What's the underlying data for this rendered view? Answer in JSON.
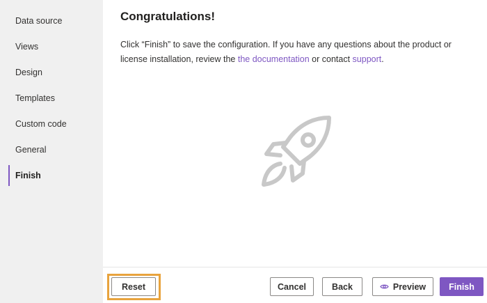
{
  "sidebar": {
    "items": [
      {
        "label": "Data source",
        "active": false
      },
      {
        "label": "Views",
        "active": false
      },
      {
        "label": "Design",
        "active": false
      },
      {
        "label": "Templates",
        "active": false
      },
      {
        "label": "Custom code",
        "active": false
      },
      {
        "label": "General",
        "active": false
      },
      {
        "label": "Finish",
        "active": true
      }
    ]
  },
  "main": {
    "title": "Congratulations!",
    "desc_before": "Click “Finish” to save the configuration. If you have any questions about the product or license installation, review the ",
    "doc_link": "the documentation",
    "desc_middle": " or contact ",
    "support_link": "support",
    "desc_end": ".",
    "illustration_icon": "rocket-icon"
  },
  "footer": {
    "reset_label": "Reset",
    "cancel_label": "Cancel",
    "back_label": "Back",
    "preview_label": "Preview",
    "preview_icon": "eye-icon",
    "finish_label": "Finish"
  },
  "colors": {
    "accent": "#7e57c2",
    "highlight": "#e8a33d",
    "sidebar_bg": "#f0f0f0"
  }
}
